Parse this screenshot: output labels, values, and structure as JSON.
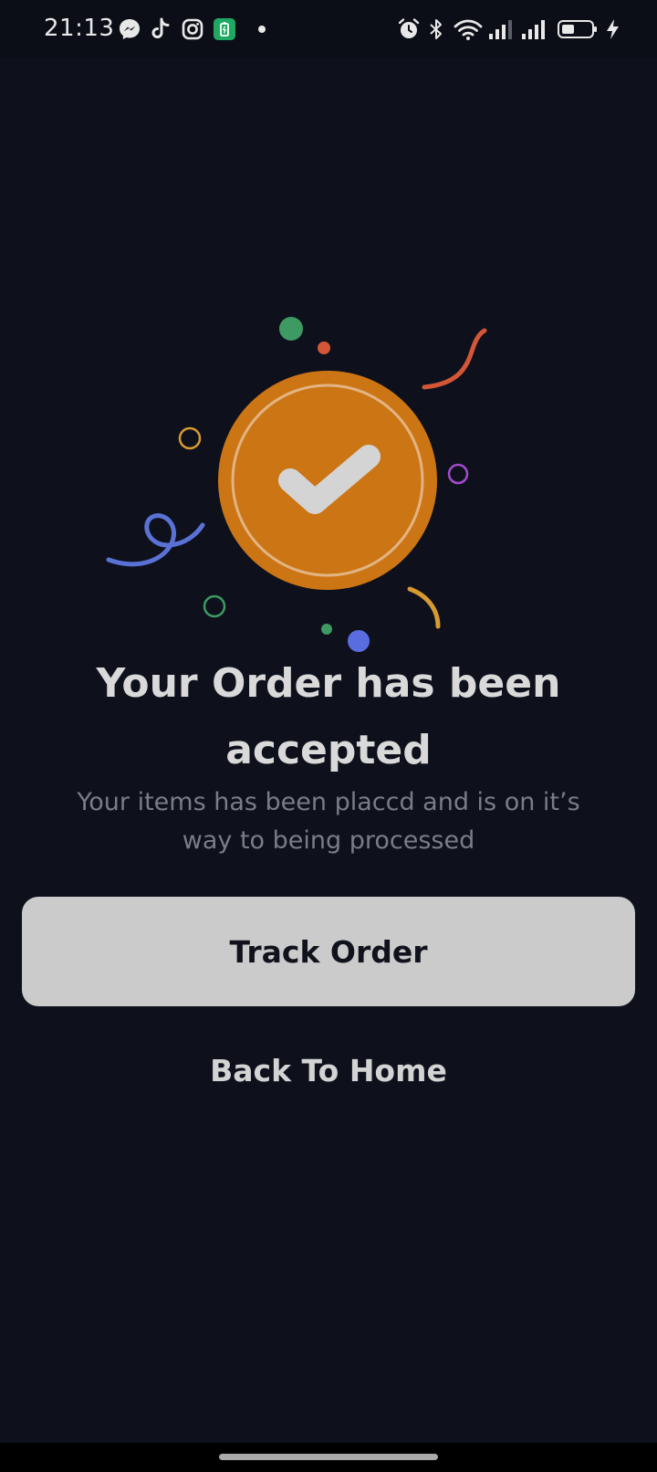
{
  "status_bar": {
    "time": "21:13",
    "left_icons": [
      "messenger-icon",
      "tiktok-icon",
      "instagram-icon",
      "battery-saver-icon",
      "dot-icon"
    ],
    "right_icons": [
      "alarm-icon",
      "bluetooth-icon",
      "wifi-icon",
      "signal-1-icon",
      "signal-2-icon",
      "battery-icon",
      "charging-icon"
    ]
  },
  "illustration": {
    "icon": "check-icon",
    "badge_color": "#cc7514",
    "check_color": "#d4d4d4"
  },
  "content": {
    "title": "Your Order has been accepted",
    "subtitle": "Your items has been placcd and is on it’s way to being processed"
  },
  "actions": {
    "track_order_label": "Track Order",
    "back_home_label": "Back To Home"
  },
  "colors": {
    "background": "#0e111c",
    "button_bg": "#cbcbcb",
    "accent_orange": "#cc7514"
  }
}
